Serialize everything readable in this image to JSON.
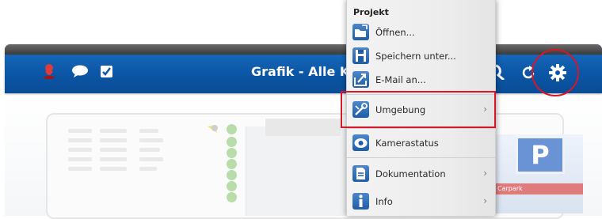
{
  "topbar": {
    "title": "Grafik  -  Alle Ka",
    "icons": [
      "user-pin-icon",
      "chat-bubble-icon",
      "checkbox-icon",
      "search-icon",
      "refresh-icon",
      "gear-icon"
    ],
    "accent_color": "#0b56a6"
  },
  "menu": {
    "header": "Projekt",
    "items": [
      {
        "label": "Öffnen...",
        "icon": "folder-open-icon"
      },
      {
        "label": "Speichern unter...",
        "icon": "save-icon"
      },
      {
        "label": "E-Mail an...",
        "icon": "share-icon"
      },
      {
        "label": "Umgebung",
        "icon": "tools-icon",
        "submenu": true
      },
      {
        "label": "Kamerastatus",
        "icon": "camera-icon"
      },
      {
        "label": "Dokumentation",
        "icon": "document-icon",
        "submenu": true
      },
      {
        "label": "Info",
        "icon": "info-icon",
        "submenu": true
      }
    ]
  },
  "background": {
    "parking_sign": "P",
    "parking_label": "Carpark"
  },
  "highlight_color": "#d8162a"
}
